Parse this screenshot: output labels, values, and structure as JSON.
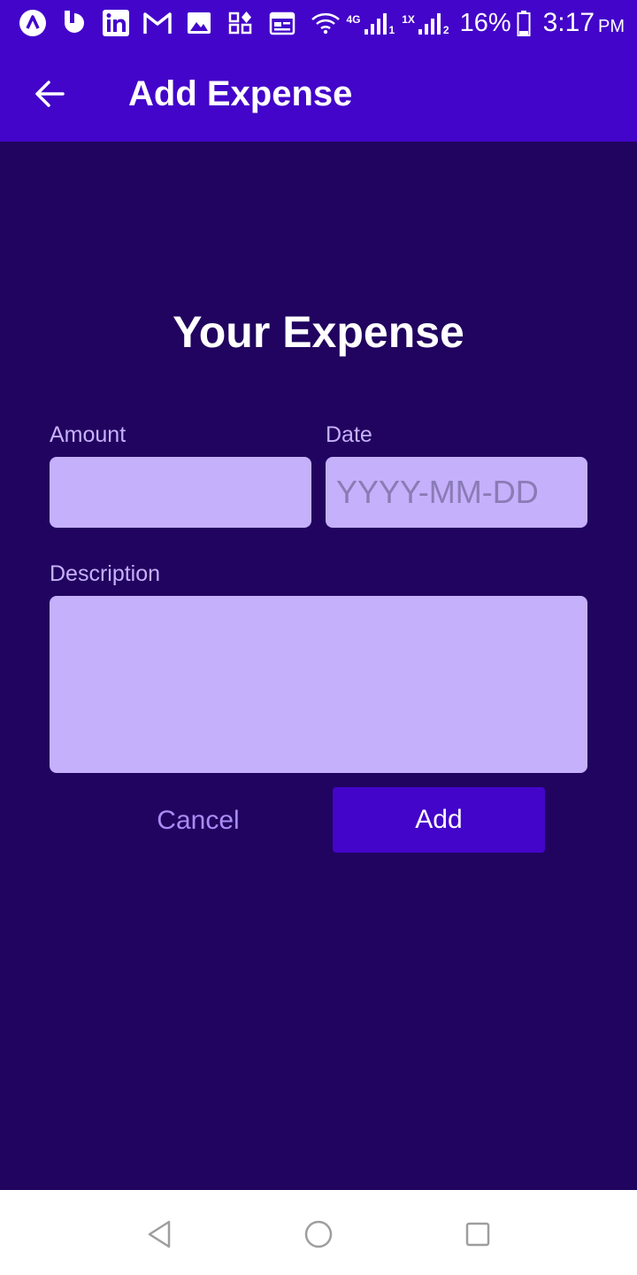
{
  "status_bar": {
    "icons": [
      "app-a-icon",
      "app-b-icon",
      "linkedin-icon",
      "gmail-icon",
      "gallery-icon",
      "widgets-icon",
      "calendar-icon"
    ],
    "wifi_icon": "wifi-icon",
    "network1_label": "4G",
    "network1_sim": "1",
    "network2_label": "1X",
    "network2_sim": "2",
    "battery_percent": "16%",
    "time": "3:17",
    "ampm": "PM"
  },
  "appbar": {
    "back_icon": "arrow-left-icon",
    "title": "Add Expense"
  },
  "form": {
    "title": "Your Expense",
    "amount_label": "Amount",
    "amount_value": "",
    "date_label": "Date",
    "date_value": "",
    "date_placeholder": "YYYY-MM-DD",
    "description_label": "Description",
    "description_value": "",
    "cancel_label": "Cancel",
    "add_label": "Add"
  },
  "nav_bar": {
    "back_icon": "nav-back-icon",
    "home_icon": "nav-home-icon",
    "recents_icon": "nav-recents-icon"
  },
  "colors": {
    "primary": "#4305c9",
    "background": "#21045f",
    "field": "#c5b0fb",
    "label": "#c7b0fb",
    "cancel_text": "#a98bf4"
  }
}
